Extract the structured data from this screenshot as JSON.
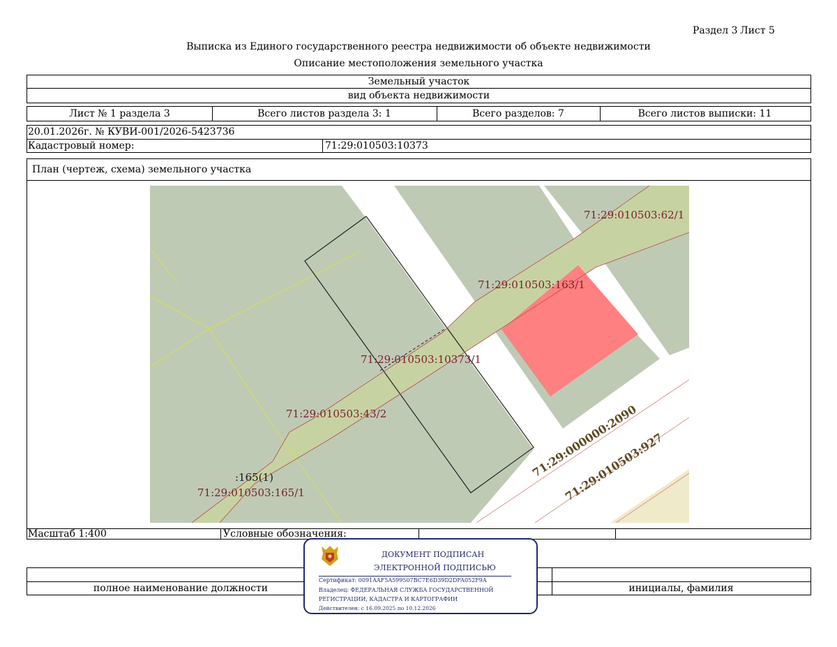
{
  "header": {
    "section_label": "Раздел 3",
    "sheet_label": "Лист 5",
    "title": "Выписка из Единого государственного реестра недвижимости об объекте недвижимости",
    "subtitle": "Описание местоположения земельного участка"
  },
  "object": {
    "name": "Земельный участок",
    "kind_caption": "вид объекта недвижимости"
  },
  "sheets": {
    "sheet_no": "Лист № 1 раздела 3",
    "total_section_sheets": "Всего листов раздела 3: 1",
    "total_sections": "Всего разделов: 7",
    "total_extract_sheets": "Всего листов выписки: 11"
  },
  "doc": {
    "date_number": "20.01.2026г. № КУВИ-001/2026-5423736",
    "cadastral_label": "Кадастровый номер:",
    "cadastral_value": "71:29:010503:10373"
  },
  "plan": {
    "title": "План (чертеж, схема) земельного участка",
    "labels": {
      "p62": "71:29:010503:62/1",
      "p163": "71:29:010503:163/1",
      "p10373": "71:29:010503:10373/1",
      "p43": "71:29:010503:43/2",
      "p165short": ":165(1)",
      "p165": "71:29:010503:165/1",
      "q2090": "71:29:000000:2090",
      "q927": "71:29:010503:927"
    },
    "colors": {
      "parcel_fill": "#bfcab5",
      "road_fill": "#c7d2a2",
      "highlight_fill": "#ff8080",
      "yellow_fill": "#efeac9",
      "label_color": "#7a1f2b"
    }
  },
  "footer": {
    "scale": "Масштаб 1:400",
    "legend": "Условные обозначения:",
    "position_caption": "полное наименование должности",
    "name_caption": "инициалы, фамилия"
  },
  "stamp": {
    "line1": "ДОКУМЕНТ ПОДПИСАН",
    "line2": "ЭЛЕКТРОННОЙ ПОДПИСЬЮ",
    "certificate": "Сертификат: 0091AAF5A599507BC7E6D39D2DFA052F9A",
    "owner1": "Владелец: ФЕДЕРАЛЬНАЯ СЛУЖБА ГОСУДАРСТВЕННОЙ",
    "owner2": "РЕГИСТРАЦИИ, КАДАСТРА И КАРТОГРАФИИ",
    "validity": "Действителен: с 16.09.2025 по 10.12.2026",
    "color": "#1e2a6e"
  }
}
